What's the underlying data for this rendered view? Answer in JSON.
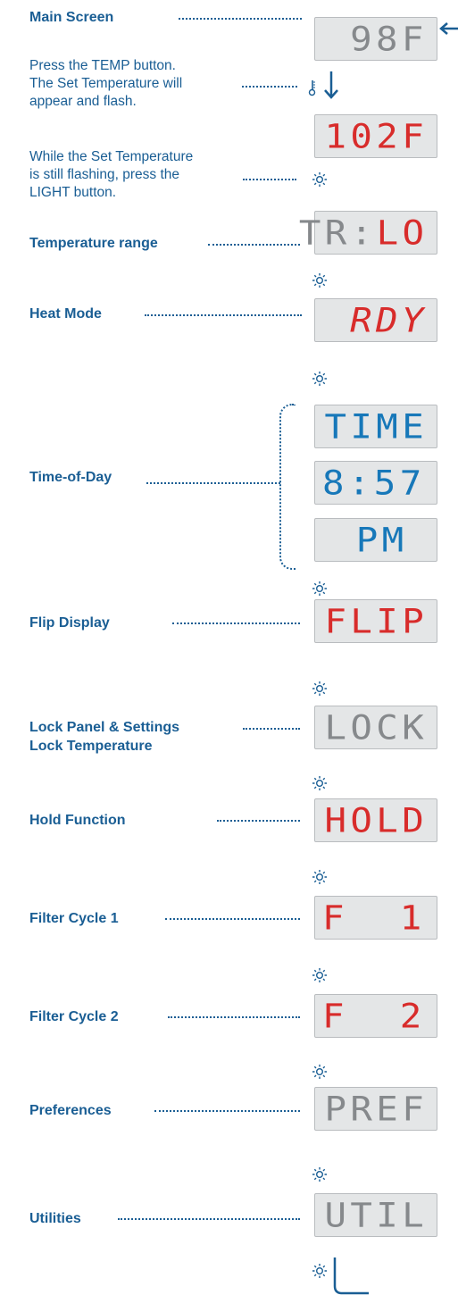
{
  "colors": {
    "blue": "#1a5e94",
    "lcd_red": "#d82c2b",
    "lcd_blue": "#1778b9",
    "lcd_gray": "#86898c",
    "lcd_bg": "#e4e6e7"
  },
  "labels": {
    "main_screen": "Main Screen",
    "press_temp_1": "Press the TEMP button.",
    "press_temp_2": "The Set Temperature will",
    "press_temp_3": "appear and flash.",
    "while_1": "While the Set Temperature",
    "while_2": "is still flashing, press the",
    "while_3": "LIGHT button.",
    "temperature_range": "Temperature range",
    "heat_mode": "Heat Mode",
    "time_of_day": "Time-of-Day",
    "flip_display": "Flip Display",
    "lock_1": "Lock Panel & Settings",
    "lock_2": "Lock Temperature",
    "hold_function": "Hold Function",
    "filter_cycle_1": "Filter Cycle 1",
    "filter_cycle_2": "Filter Cycle 2",
    "preferences": "Preferences",
    "utilities": "Utilities"
  },
  "displays": {
    "main": "98F",
    "set_temp": "102F",
    "tr_prefix": "TR:",
    "tr_value": "LO",
    "heat": "RDY",
    "time": "TIME",
    "clock": "8:57",
    "ampm": "PM",
    "flip": "FLIP",
    "lock": "LOCK",
    "hold": "HOLD",
    "filter1": "F  1",
    "filter2": "F  2",
    "pref": "PREF",
    "util": "UTIL"
  },
  "icons": {
    "light": "sun-icon",
    "temp": "thermometer-icon",
    "down": "arrow-down-icon",
    "return": "arrow-left-icon"
  }
}
